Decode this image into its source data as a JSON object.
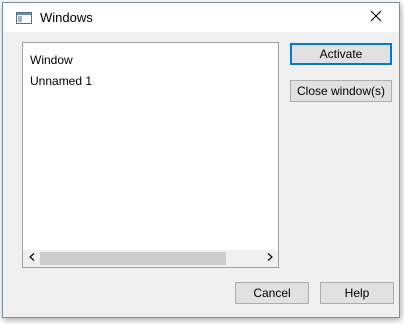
{
  "window": {
    "title": "Windows"
  },
  "list": {
    "items": [
      {
        "label": "Window"
      },
      {
        "label": "Unnamed 1"
      }
    ]
  },
  "buttons": {
    "activate": "Activate",
    "close_windows": "Close window(s)",
    "cancel": "Cancel",
    "help": "Help"
  },
  "icons": {
    "app": "window-icon",
    "close": "close-icon",
    "scroll_left": "chevron-left-icon",
    "scroll_right": "chevron-right-icon"
  },
  "colors": {
    "dialog_bg": "#f0f0f0",
    "default_button_border": "#0078d7",
    "button_bg": "#e1e1e1"
  }
}
